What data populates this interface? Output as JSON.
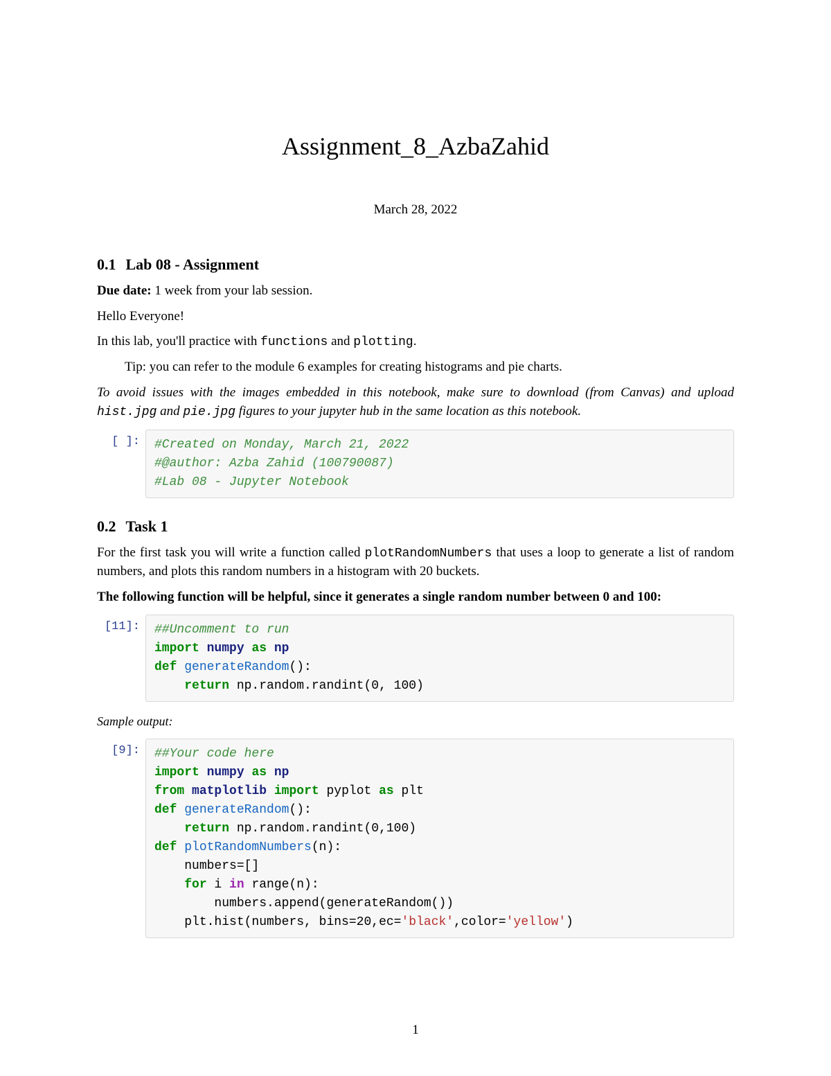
{
  "title": "Assignment_8_AzbaZahid",
  "date": "March 28, 2022",
  "section1": {
    "num": "0.1",
    "title": "Lab 08 - Assignment",
    "due_label": "Due date:",
    "due_text": " 1 week from your lab session.",
    "hello": "Hello Everyone!",
    "intro_pre": "In this lab, you'll practice with ",
    "intro_code1": "functions",
    "intro_mid": " and ",
    "intro_code2": "plotting",
    "intro_post": ".",
    "tip": "Tip: you can refer to the module 6 examples for creating histograms and pie charts.",
    "note_pre": "To avoid issues with the images embedded in this notebook, make sure to download (from Canvas) and upload ",
    "note_file1": "hist.jpg",
    "note_mid": " and ",
    "note_file2": "pie.jpg",
    "note_post": " figures to your jupyter hub in the same location as this notebook."
  },
  "cell1": {
    "prompt": "[ ]:",
    "line1": "#Created on Monday, March 21, 2022",
    "line2": "#@author: Azba Zahid (100790087)",
    "line3": "#Lab 08 - Jupyter Notebook"
  },
  "section2": {
    "num": "0.2",
    "title": "Task 1",
    "desc_pre": "For the first task you will write a function called ",
    "desc_code": "plotRandomNumbers",
    "desc_post": " that uses a loop to generate a list of random numbers, and plots this random numbers in a histogram with 20 buckets.",
    "helpful": "The following function will be helpful, since it generates a single random number between 0 and 100:"
  },
  "cell2": {
    "prompt": "[11]:",
    "c": {
      "comment": "##Uncomment to run",
      "imp": "import",
      "numpy": "numpy",
      "as": "as",
      "np": "np",
      "def": "def",
      "fn": "generateRandom",
      "paren": "():",
      "ret": "return",
      "body": " np.random.randint(0, 100)"
    }
  },
  "sample_output": "Sample output:",
  "cell3": {
    "prompt": "[9]:",
    "c": {
      "comment": "##Your code here",
      "imp": "import",
      "numpy": "numpy",
      "as": "as",
      "np": "np",
      "from": "from",
      "mpl": "matplotlib",
      "pyplot": " pyplot ",
      "plt": "plt",
      "def": "def",
      "gen": "generateRandom",
      "paren": "():",
      "ret": "return",
      "gret": " np.random.randint(0,100)",
      "plotfn": "plotRandomNumbers",
      "plotparen": "(n):",
      "numbers": "numbers=[]",
      "for": "for",
      "i": " i ",
      "in": "in",
      "range": " range(n):",
      "append": "numbers.append(generateRandom())",
      "hist_pre": "plt.hist(numbers, bins=20,ec=",
      "hist_s1": "'black'",
      "hist_mid": ",color=",
      "hist_s2": "'yellow'",
      "hist_post": ")"
    }
  },
  "page_number": "1"
}
